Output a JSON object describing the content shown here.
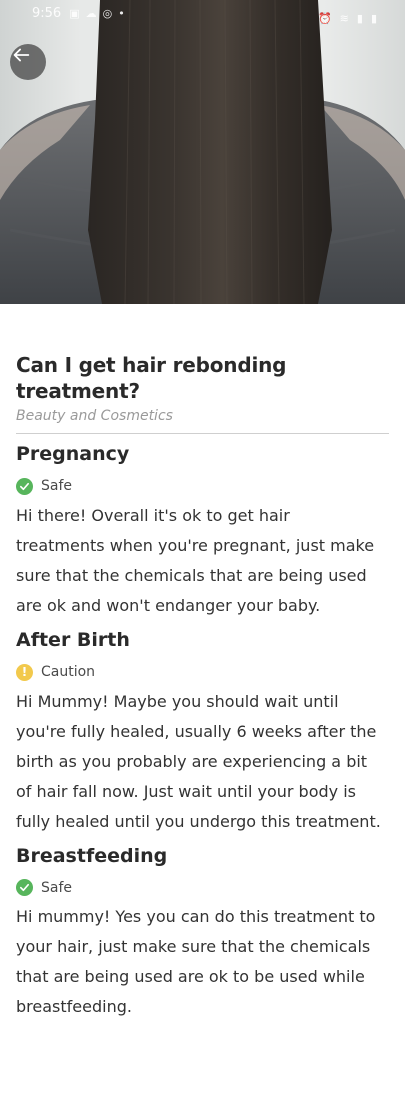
{
  "status_bar": {
    "time": "9:56"
  },
  "article": {
    "title": "Can I get hair rebonding treatment?",
    "category": "Beauty and Cosmetics"
  },
  "sections": [
    {
      "heading": "Pregnancy",
      "status": "Safe",
      "status_type": "safe",
      "text": "Hi there! Overall it's ok to get hair treatments when you're pregnant, just make sure that the chemicals that are being used are ok and won't endanger your baby."
    },
    {
      "heading": "After Birth",
      "status": "Caution",
      "status_type": "caution",
      "text": "Hi Mummy! Maybe you should wait until you're fully healed, usually 6 weeks after the birth as you probably are experiencing a bit of hair fall now. Just wait until your body is fully healed until you undergo this treatment."
    },
    {
      "heading": "Breastfeeding",
      "status": "Safe",
      "status_type": "safe",
      "text": "Hi mummy! Yes you can do this treatment to your hair, just make sure that the chemicals that are being used are ok to be used while breastfeeding."
    }
  ],
  "colors": {
    "safe": "#57b55c",
    "caution": "#f2c94c"
  },
  "icons": {
    "back": "arrow-left-icon",
    "safe": "check-circle-icon",
    "caution": "exclamation-circle-icon"
  }
}
